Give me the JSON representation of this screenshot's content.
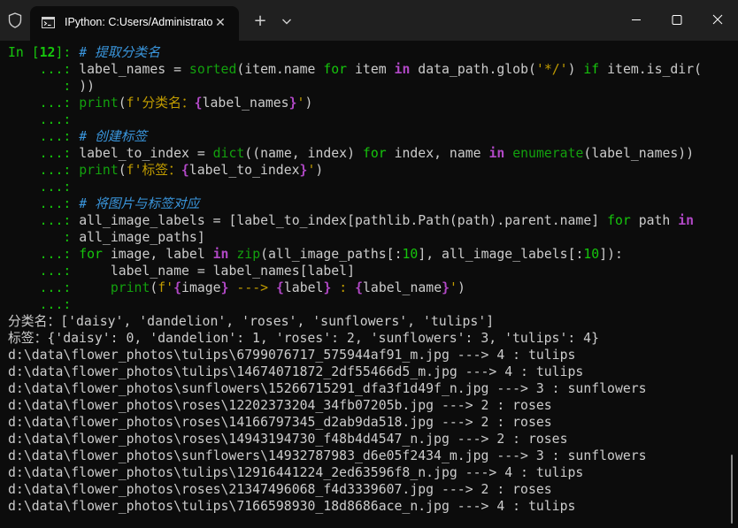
{
  "window": {
    "tab_title": "IPython: C:Users/Administrato",
    "tab_icon": "terminal-icon",
    "close_tab_glyph": "✕",
    "new_tab_glyph": "+",
    "controls": [
      "minimize-icon",
      "maximize-icon",
      "close-icon"
    ]
  },
  "colors": {
    "background": "#0c0c0c",
    "titlebar": "#202020",
    "prompt_green": "#16c60c",
    "comment_blue": "#3a96dd",
    "keyword_purple": "#b148c6",
    "string_yellow": "#c19c00",
    "text": "#cccccc"
  },
  "lines": [
    [
      {
        "t": "In [",
        "c": "p-in"
      },
      {
        "t": "12",
        "c": "p-num"
      },
      {
        "t": "]: ",
        "c": "p-in"
      },
      {
        "t": "# 提取分类名",
        "c": "tk-comment"
      }
    ],
    [
      {
        "t": "    ...: ",
        "c": "p-cont"
      },
      {
        "t": "label_names = ",
        "c": "tk-plain"
      },
      {
        "t": "sorted",
        "c": "tk-builtin"
      },
      {
        "t": "(item.name ",
        "c": "tk-plain"
      },
      {
        "t": "for",
        "c": "tk-kw"
      },
      {
        "t": " item ",
        "c": "tk-plain"
      },
      {
        "t": "in",
        "c": "tk-kw2"
      },
      {
        "t": " data_path.glob(",
        "c": "tk-plain"
      },
      {
        "t": "'*/'",
        "c": "tk-str"
      },
      {
        "t": ") ",
        "c": "tk-plain"
      },
      {
        "t": "if",
        "c": "tk-kw"
      },
      {
        "t": " item.is_dir(",
        "c": "tk-plain"
      }
    ],
    [
      {
        "t": "       : ",
        "c": "p-cont"
      },
      {
        "t": "))",
        "c": "tk-plain"
      }
    ],
    [
      {
        "t": "    ...: ",
        "c": "p-cont"
      },
      {
        "t": "print",
        "c": "tk-builtin"
      },
      {
        "t": "(",
        "c": "tk-plain"
      },
      {
        "t": "f'分类名：",
        "c": "tk-str"
      },
      {
        "t": "{",
        "c": "tk-interp"
      },
      {
        "t": "label_names",
        "c": "tk-plain"
      },
      {
        "t": "}",
        "c": "tk-interp"
      },
      {
        "t": "'",
        "c": "tk-str"
      },
      {
        "t": ")",
        "c": "tk-plain"
      }
    ],
    [
      {
        "t": "    ...: ",
        "c": "p-cont"
      }
    ],
    [
      {
        "t": "    ...: ",
        "c": "p-cont"
      },
      {
        "t": "# 创建标签",
        "c": "tk-comment"
      }
    ],
    [
      {
        "t": "    ...: ",
        "c": "p-cont"
      },
      {
        "t": "label_to_index = ",
        "c": "tk-plain"
      },
      {
        "t": "dict",
        "c": "tk-builtin"
      },
      {
        "t": "((name, index) ",
        "c": "tk-plain"
      },
      {
        "t": "for",
        "c": "tk-kw"
      },
      {
        "t": " index, name ",
        "c": "tk-plain"
      },
      {
        "t": "in",
        "c": "tk-kw2"
      },
      {
        "t": " ",
        "c": "tk-plain"
      },
      {
        "t": "enumerate",
        "c": "tk-builtin"
      },
      {
        "t": "(label_names))",
        "c": "tk-plain"
      }
    ],
    [
      {
        "t": "    ...: ",
        "c": "p-cont"
      },
      {
        "t": "print",
        "c": "tk-builtin"
      },
      {
        "t": "(",
        "c": "tk-plain"
      },
      {
        "t": "f'标签：",
        "c": "tk-str"
      },
      {
        "t": "{",
        "c": "tk-interp"
      },
      {
        "t": "label_to_index",
        "c": "tk-plain"
      },
      {
        "t": "}",
        "c": "tk-interp"
      },
      {
        "t": "'",
        "c": "tk-str"
      },
      {
        "t": ")",
        "c": "tk-plain"
      }
    ],
    [
      {
        "t": "    ...: ",
        "c": "p-cont"
      }
    ],
    [
      {
        "t": "    ...: ",
        "c": "p-cont"
      },
      {
        "t": "# 将图片与标签对应",
        "c": "tk-comment"
      }
    ],
    [
      {
        "t": "    ...: ",
        "c": "p-cont"
      },
      {
        "t": "all_image_labels = [label_to_index[pathlib.Path(path).parent.name] ",
        "c": "tk-plain"
      },
      {
        "t": "for",
        "c": "tk-kw"
      },
      {
        "t": " path ",
        "c": "tk-plain"
      },
      {
        "t": "in",
        "c": "tk-kw2"
      }
    ],
    [
      {
        "t": "       : ",
        "c": "p-cont"
      },
      {
        "t": "all_image_paths]",
        "c": "tk-plain"
      }
    ],
    [
      {
        "t": "    ...: ",
        "c": "p-cont"
      },
      {
        "t": "for",
        "c": "tk-kw"
      },
      {
        "t": " image, label ",
        "c": "tk-plain"
      },
      {
        "t": "in",
        "c": "tk-kw2"
      },
      {
        "t": " ",
        "c": "tk-plain"
      },
      {
        "t": "zip",
        "c": "tk-builtin"
      },
      {
        "t": "(all_image_paths[:",
        "c": "tk-plain"
      },
      {
        "t": "10",
        "c": "tk-num"
      },
      {
        "t": "], all_image_labels[:",
        "c": "tk-plain"
      },
      {
        "t": "10",
        "c": "tk-num"
      },
      {
        "t": "]):",
        "c": "tk-plain"
      }
    ],
    [
      {
        "t": "    ...: ",
        "c": "p-cont"
      },
      {
        "t": "    label_name = label_names[label]",
        "c": "tk-plain"
      }
    ],
    [
      {
        "t": "    ...: ",
        "c": "p-cont"
      },
      {
        "t": "    ",
        "c": "tk-plain"
      },
      {
        "t": "print",
        "c": "tk-builtin"
      },
      {
        "t": "(",
        "c": "tk-plain"
      },
      {
        "t": "f'",
        "c": "tk-str"
      },
      {
        "t": "{",
        "c": "tk-interp"
      },
      {
        "t": "image",
        "c": "tk-plain"
      },
      {
        "t": "}",
        "c": "tk-interp"
      },
      {
        "t": " ---> ",
        "c": "tk-str"
      },
      {
        "t": "{",
        "c": "tk-interp"
      },
      {
        "t": "label",
        "c": "tk-plain"
      },
      {
        "t": "}",
        "c": "tk-interp"
      },
      {
        "t": " : ",
        "c": "tk-str"
      },
      {
        "t": "{",
        "c": "tk-interp"
      },
      {
        "t": "label_name",
        "c": "tk-plain"
      },
      {
        "t": "}",
        "c": "tk-interp"
      },
      {
        "t": "'",
        "c": "tk-str"
      },
      {
        "t": ")",
        "c": "tk-plain"
      }
    ],
    [
      {
        "t": "    ...: ",
        "c": "p-cont"
      }
    ],
    [
      {
        "t": "分类名：['daisy', 'dandelion', 'roses', 'sunflowers', 'tulips']",
        "c": "tk-plain"
      }
    ],
    [
      {
        "t": "标签：{'daisy': 0, 'dandelion': 1, 'roses': 2, 'sunflowers': 3, 'tulips': 4}",
        "c": "tk-plain"
      }
    ],
    [
      {
        "t": "d:\\data\\flower_photos\\tulips\\6799076717_575944af91_m.jpg ---> 4 : tulips",
        "c": "tk-plain"
      }
    ],
    [
      {
        "t": "d:\\data\\flower_photos\\tulips\\14674071872_2df55466d5_m.jpg ---> 4 : tulips",
        "c": "tk-plain"
      }
    ],
    [
      {
        "t": "d:\\data\\flower_photos\\sunflowers\\15266715291_dfa3f1d49f_n.jpg ---> 3 : sunflowers",
        "c": "tk-plain"
      }
    ],
    [
      {
        "t": "d:\\data\\flower_photos\\roses\\12202373204_34fb07205b.jpg ---> 2 : roses",
        "c": "tk-plain"
      }
    ],
    [
      {
        "t": "d:\\data\\flower_photos\\roses\\14166797345_d2ab9da518.jpg ---> 2 : roses",
        "c": "tk-plain"
      }
    ],
    [
      {
        "t": "d:\\data\\flower_photos\\roses\\14943194730_f48b4d4547_n.jpg ---> 2 : roses",
        "c": "tk-plain"
      }
    ],
    [
      {
        "t": "d:\\data\\flower_photos\\sunflowers\\14932787983_d6e05f2434_m.jpg ---> 3 : sunflowers",
        "c": "tk-plain"
      }
    ],
    [
      {
        "t": "d:\\data\\flower_photos\\tulips\\12916441224_2ed63596f8_n.jpg ---> 4 : tulips",
        "c": "tk-plain"
      }
    ],
    [
      {
        "t": "d:\\data\\flower_photos\\roses\\21347496068_f4d3339607.jpg ---> 2 : roses",
        "c": "tk-plain"
      }
    ],
    [
      {
        "t": "d:\\data\\flower_photos\\tulips\\7166598930_18d8686ace_n.jpg ---> 4 : tulips",
        "c": "tk-plain"
      }
    ]
  ]
}
